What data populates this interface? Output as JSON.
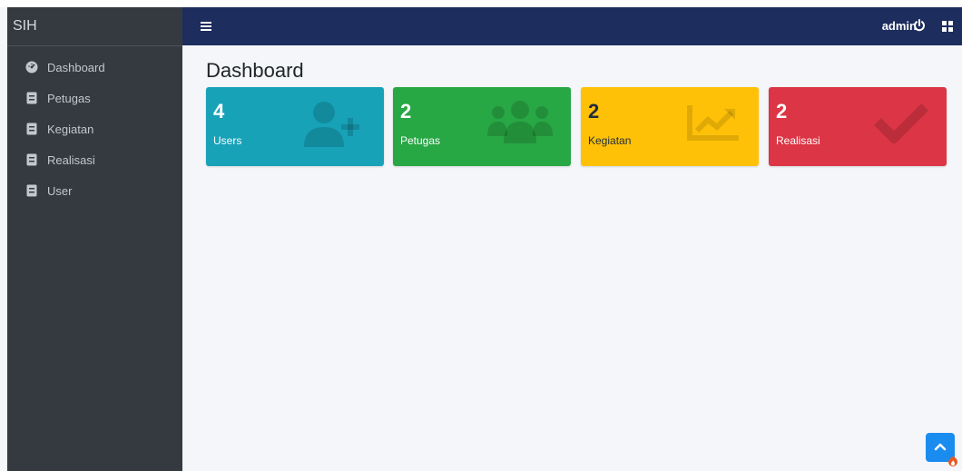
{
  "sidebar": {
    "brand": "SIH",
    "items": [
      {
        "label": "Dashboard",
        "icon": "dashboard-icon"
      },
      {
        "label": "Petugas",
        "icon": "book-icon"
      },
      {
        "label": "Kegiatan",
        "icon": "book-icon"
      },
      {
        "label": "Realisasi",
        "icon": "book-icon"
      },
      {
        "label": "User",
        "icon": "book-icon"
      }
    ]
  },
  "navbar": {
    "menu_icon": "hamburger-icon",
    "user_label": "admin",
    "logout_icon": "power-icon",
    "apps_icon": "grid-icon"
  },
  "main": {
    "title": "Dashboard",
    "boxes": [
      {
        "count": "4",
        "label": "Users",
        "color": "#17a2b8",
        "icon": "user-plus-icon"
      },
      {
        "count": "2",
        "label": "Petugas",
        "color": "#28a745",
        "icon": "users-icon"
      },
      {
        "count": "2",
        "label": "Kegiatan",
        "color": "#ffc107",
        "icon": "chart-line-icon"
      },
      {
        "count": "2",
        "label": "Realisasi",
        "color": "#dc3545",
        "icon": "check-icon"
      }
    ]
  },
  "floating": {
    "scroll_top_icon": "chevron-up-icon",
    "debug_icon": "flame-icon"
  }
}
